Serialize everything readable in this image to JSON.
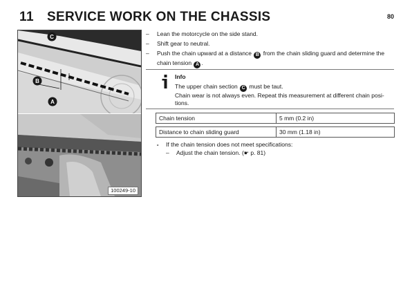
{
  "header": {
    "chapter_number": "11",
    "chapter_title": "SERVICE WORK ON THE CHASSIS",
    "page_number": "80"
  },
  "figure": {
    "code": "100249-10",
    "callouts": {
      "c": "C",
      "b": "B",
      "a": "A"
    }
  },
  "steps": [
    {
      "dash": "–",
      "text": "Lean the motorcycle on the side stand."
    },
    {
      "dash": "–",
      "text": "Shift gear to neutral."
    },
    {
      "dash": "–",
      "text_1": "Push the chain upward at a distance",
      "badge_1": "B",
      "text_2": "from the chain sliding guard and determine the chain tension",
      "badge_2": "A",
      "text_3": "."
    }
  ],
  "info": {
    "title": "Info",
    "line1_before": "The upper chain section",
    "line1_badge": "C",
    "line1_after": "must be taut.",
    "line2": "Chain wear is not always even. Repeat this measurement at different chain posi-tions."
  },
  "specs": [
    {
      "label": "Chain tension",
      "value": "5 mm (0.2 in)"
    },
    {
      "label": "Distance to chain sliding guard",
      "value": "30 mm (1.18 in)"
    }
  ],
  "condition": {
    "bullet": "∘",
    "text": "If the chain tension does not meet specifications:"
  },
  "substep": {
    "dash": "–",
    "text": "Adjust the chain tension. (",
    "ref_icon": "☛",
    "ref_text": " p. 81)"
  }
}
